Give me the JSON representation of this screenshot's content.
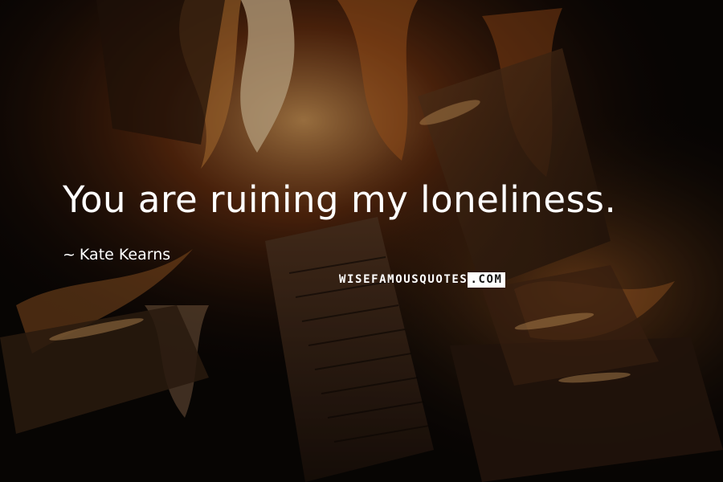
{
  "quote": {
    "text": "You are ruining my loneliness.",
    "author_prefix": "~",
    "author": "Kate Kearns"
  },
  "watermark": {
    "left_text": "WISEFAMOUSQUOTES",
    "right_text": ".COM"
  },
  "background": {
    "subject": "campfire-flames-and-burning-logs",
    "colors": {
      "dark": "#0b0705",
      "ember": "#7a3512",
      "flame": "#d98a3a",
      "highlight": "#f6d3a0"
    }
  }
}
